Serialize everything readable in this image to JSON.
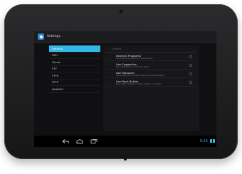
{
  "app": {
    "title": "Settings"
  },
  "sidebar": {
    "items": [
      {
        "label": "General",
        "active": true
      },
      {
        "label": "SSH",
        "active": false
      },
      {
        "label": "Telnet",
        "active": false
      },
      {
        "label": "FTP",
        "active": false
      },
      {
        "label": "FTPS",
        "active": false
      },
      {
        "label": "SFTP",
        "active": false
      },
      {
        "label": "WebDAV",
        "active": false
      }
    ]
  },
  "detail": {
    "section_header": "General",
    "preferences": [
      {
        "title": "External Programs",
        "summary": "Use external programs for opening files",
        "checked": false
      },
      {
        "title": "Use Suggestion",
        "summary": "Use suggestions in hostname input",
        "checked": false
      },
      {
        "title": "Ask Password",
        "summary": "Ask password and passphrase before authentication",
        "checked": false
      },
      {
        "title": "Use Back Button",
        "summary": "Back button exits the current activity or directory",
        "checked": false
      }
    ]
  },
  "status_bar": {
    "time": "9:15"
  },
  "colors": {
    "accent": "#33b5e5",
    "background": "#101012",
    "bezel": "#1f1f21"
  },
  "icons": {
    "app": "settings-app-icon",
    "back": "back-icon",
    "home": "home-icon",
    "recents": "recent-apps-icon",
    "wifi": "wifi-icon",
    "battery": "battery-icon"
  }
}
